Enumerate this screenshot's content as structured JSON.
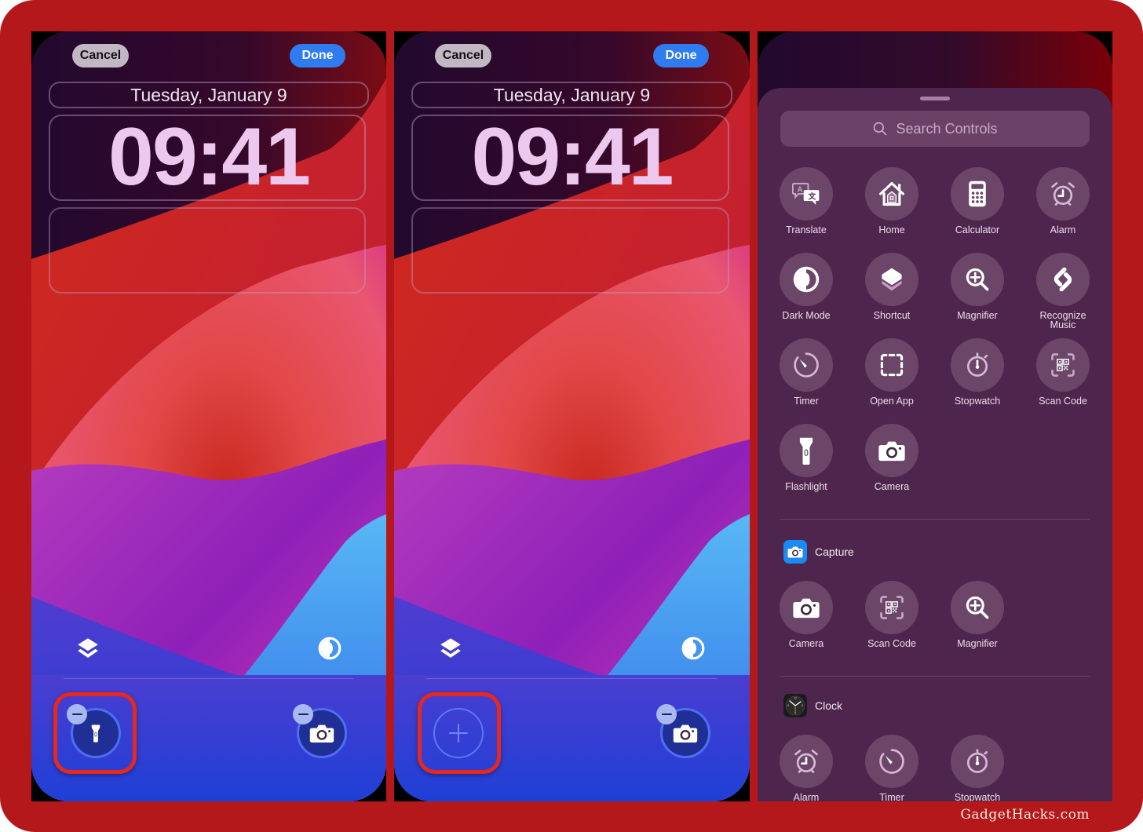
{
  "colors": {
    "frame": "#b5181b",
    "done_button": "#2f7bf0",
    "highlight": "#e9271c",
    "sheet_bg": "#4e264d",
    "capture_tile": "#1a8af5"
  },
  "panels": [
    {
      "cancel_label": "Cancel",
      "done_label": "Done",
      "date": "Tuesday, January 9",
      "time": "09:41",
      "top_left_icon": "shortcut-layers-icon",
      "top_right_icon": "dark-mode-icon",
      "bottom_left_control": {
        "icon": "flashlight-icon",
        "state": "removable",
        "highlighted": true
      },
      "bottom_right_control": {
        "icon": "camera-icon",
        "state": "removable"
      }
    },
    {
      "cancel_label": "Cancel",
      "done_label": "Done",
      "date": "Tuesday, January 9",
      "time": "09:41",
      "top_left_icon": "shortcut-layers-icon",
      "top_right_icon": "dark-mode-icon",
      "bottom_left_control": {
        "icon": "plus-icon",
        "state": "empty-slot",
        "highlighted": true
      },
      "bottom_right_control": {
        "icon": "camera-icon",
        "state": "removable"
      }
    }
  ],
  "gallery": {
    "search_placeholder": "Search Controls",
    "controls": [
      {
        "label": "Translate",
        "icon": "translate-icon"
      },
      {
        "label": "Home",
        "icon": "home-icon"
      },
      {
        "label": "Calculator",
        "icon": "calculator-icon"
      },
      {
        "label": "Alarm",
        "icon": "alarm-icon"
      },
      {
        "label": "Dark Mode",
        "icon": "dark-mode-icon"
      },
      {
        "label": "Shortcut",
        "icon": "shortcut-icon"
      },
      {
        "label": "Magnifier",
        "icon": "magnifier-icon"
      },
      {
        "label": "Recognize Music",
        "icon": "shazam-icon"
      },
      {
        "label": "Timer",
        "icon": "timer-icon"
      },
      {
        "label": "Open App",
        "icon": "open-app-icon"
      },
      {
        "label": "Stopwatch",
        "icon": "stopwatch-icon"
      },
      {
        "label": "Scan Code",
        "icon": "scan-code-icon"
      },
      {
        "label": "Flashlight",
        "icon": "flashlight-icon"
      },
      {
        "label": "Camera",
        "icon": "camera-icon"
      }
    ],
    "groups": [
      {
        "title": "Capture",
        "app_icon": "camera-app-icon",
        "controls": [
          {
            "label": "Camera",
            "icon": "camera-icon"
          },
          {
            "label": "Scan Code",
            "icon": "scan-code-icon"
          },
          {
            "label": "Magnifier",
            "icon": "magnifier-icon"
          }
        ]
      },
      {
        "title": "Clock",
        "app_icon": "clock-app-icon",
        "controls": [
          {
            "label": "Alarm",
            "icon": "alarm-icon"
          },
          {
            "label": "Timer",
            "icon": "timer-icon"
          },
          {
            "label": "Stopwatch",
            "icon": "stopwatch-icon"
          }
        ]
      }
    ]
  },
  "watermark": "GadgetHacks.com"
}
